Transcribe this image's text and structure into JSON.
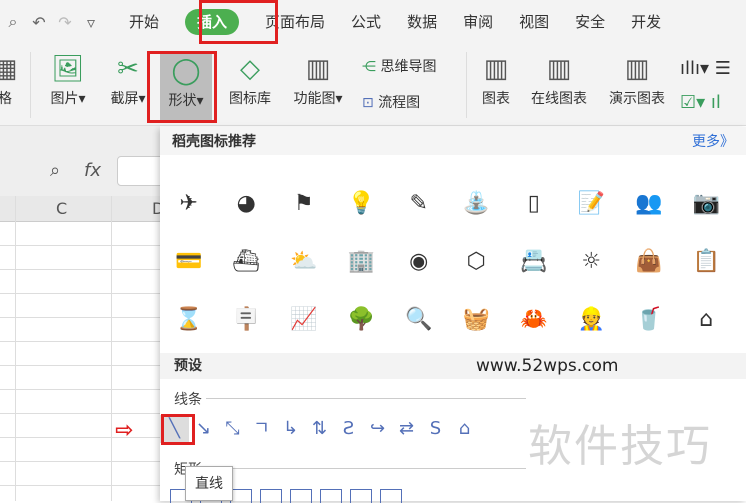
{
  "quick_access": [
    "preview-icon",
    "undo-icon",
    "redo-icon",
    "customize-icon"
  ],
  "tabs": [
    "开始",
    "插入",
    "页面布局",
    "公式",
    "数据",
    "审阅",
    "视图",
    "安全",
    "开发"
  ],
  "active_tab": "插入",
  "toolbar": {
    "table": "格",
    "picture": "图片",
    "screenshot": "截屏",
    "shapes": "形状",
    "icon_library": "图标库",
    "function_chart": "功能图",
    "mind_map": "思维导图",
    "flowchart": "流程图",
    "chart": "图表",
    "online_chart": "在线图表",
    "demo_chart": "演示图表"
  },
  "formula_bar": {
    "fx": "fx",
    "value": ""
  },
  "columns": [
    "C",
    "D"
  ],
  "popup": {
    "title": "稻壳图标推荐",
    "more": "更多》",
    "preset": "预设",
    "lines_label": "线条",
    "rect_label": "矩形",
    "watermark": "www.52wps.com",
    "icons": [
      "✈",
      "◕",
      "⚑",
      "💡",
      "✎",
      "⛲",
      "▯",
      "📝",
      "👥",
      "📷",
      "💳",
      "⛴",
      "⛅",
      "🏢",
      "◉",
      "⬡",
      "📇",
      "☼",
      "👜",
      "📋",
      "⌛",
      "🪧",
      "📈",
      "🌳",
      "🔍",
      "🧺",
      "🦀",
      "👷",
      "🥤",
      "⌂"
    ],
    "lines": [
      "╲",
      "↘",
      "⤡",
      "ㄱ",
      "↳",
      "⇅",
      "Ƨ",
      "↪",
      "⇄",
      "S",
      "⌂"
    ]
  },
  "tooltip": "直线",
  "overlay_watermark": "软件技巧",
  "colors": {
    "accent": "#4caf50",
    "highlight": "#e02020",
    "link": "#2f6fd6"
  }
}
